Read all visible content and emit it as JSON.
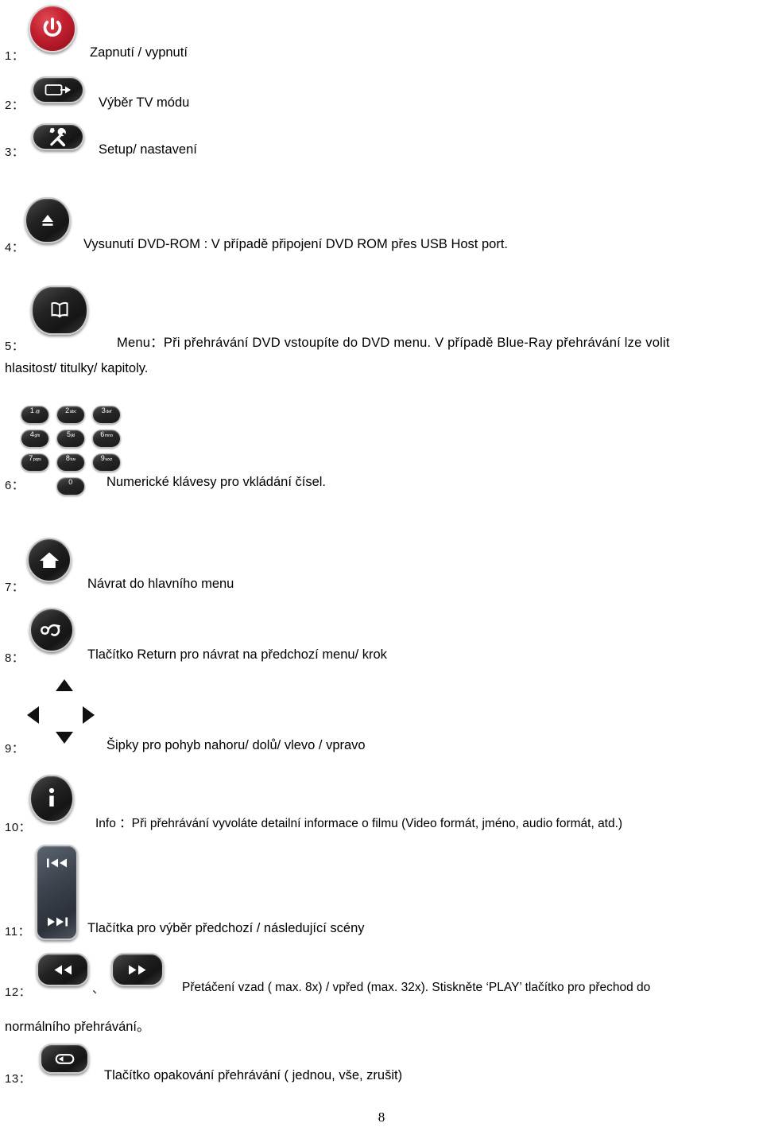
{
  "page": {
    "number": "8",
    "language": "cs"
  },
  "items": [
    {
      "num": "1：",
      "icon": "power-icon",
      "text": "Zapnutí / vypnutí"
    },
    {
      "num": "2：",
      "icon": "tv-mode-icon",
      "text": "Výběr TV módu"
    },
    {
      "num": "3：",
      "icon": "setup-tools-icon",
      "text": "Setup/ nastavení"
    },
    {
      "num": "4：",
      "icon": "eject-icon",
      "text": "Vysunutí DVD-ROM : V případě připojení DVD ROM přes USB Host port."
    },
    {
      "num": "5：",
      "icon": "book-menu-icon",
      "text_line1": "Menu：Při přehrávání DVD vstoupíte do DVD menu. V případě Blue-Ray přehrávání lze volit",
      "text_line2": "hlasitost/ titulky/ kapitoly."
    },
    {
      "num": "6：",
      "icon": "numeric-keypad-icon",
      "text": "Numerické klávesy pro vkládání čísel."
    },
    {
      "num": "7：",
      "icon": "home-icon",
      "text": "Návrat do hlavního menu"
    },
    {
      "num": "8：",
      "icon": "return-icon",
      "text": "Tlačítko Return pro návrat na předchozí menu/ krok"
    },
    {
      "num": "9：",
      "icon": "dpad-arrows-icon",
      "text": "Šipky pro pohyb nahoru/ dolů/ vlevo / vpravo"
    },
    {
      "num": "10：",
      "icon": "info-icon",
      "text": "Info ：Při přehrávání vyvoláte detailní informace o filmu (Video formát, jméno, audio formát, atd.)"
    },
    {
      "num": "11：",
      "icon": "prev-next-track-icon",
      "text": "Tlačítka pro výběr předchozí / následující scény"
    },
    {
      "num": "12：",
      "icon": "rewind-forward-icon",
      "separator": "、",
      "text_line1": "Přetáčení vzad ( max. 8x) / vpřed (max. 32x). Stiskněte ‘PLAY’ tlačítko pro přechod do",
      "text_line2": "normálního přehrávání。"
    },
    {
      "num": "13：",
      "icon": "repeat-icon",
      "text": "Tlačítko opakování přehrávání ( jednou, vše, zrušit)"
    }
  ],
  "keypad": {
    "keys": [
      {
        "digit": "1",
        "letters": ".@"
      },
      {
        "digit": "2",
        "letters": "abc"
      },
      {
        "digit": "3",
        "letters": "def"
      },
      {
        "digit": "4",
        "letters": "ghi"
      },
      {
        "digit": "5",
        "letters": "jkl"
      },
      {
        "digit": "6",
        "letters": "mno"
      },
      {
        "digit": "7",
        "letters": "pqrs"
      },
      {
        "digit": "8",
        "letters": "tuv"
      },
      {
        "digit": "9",
        "letters": "wxz"
      },
      {
        "digit": "0",
        "letters": ""
      }
    ]
  },
  "colors": {
    "power_red": "#c3202f",
    "button_dark": "#232323",
    "button_slate": "#3d444e",
    "text": "#000000",
    "background": "#ffffff"
  }
}
